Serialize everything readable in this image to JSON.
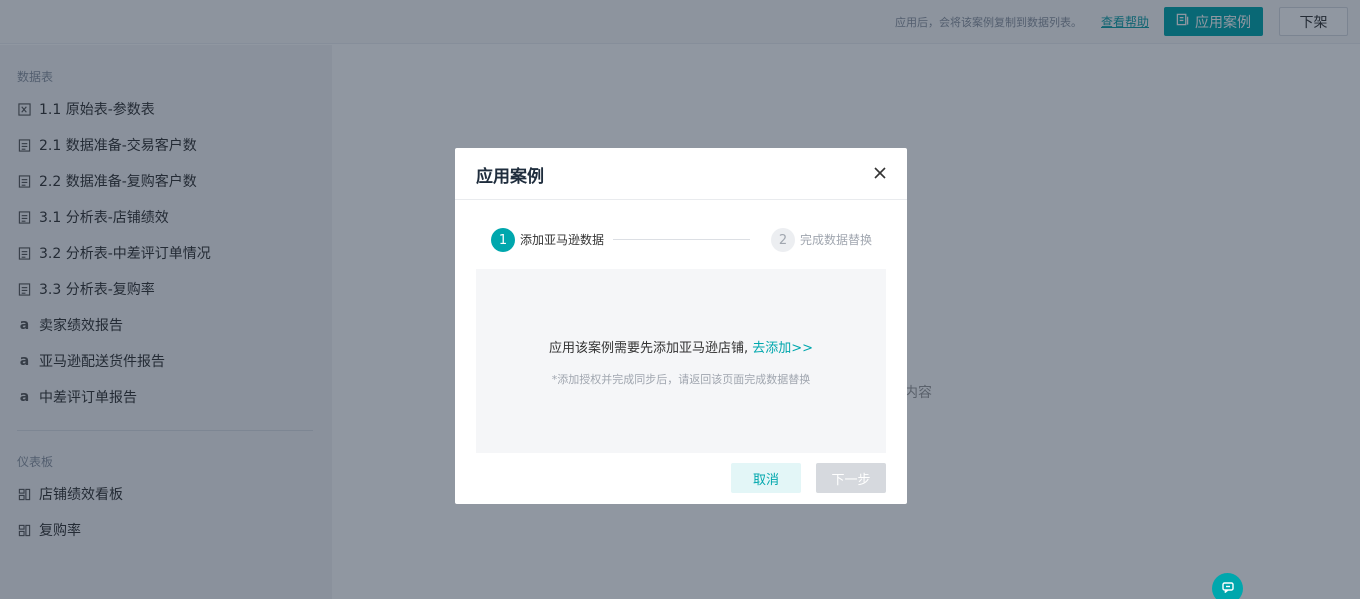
{
  "topbar": {
    "hint": "应用后，会将该案例复制到数据列表。",
    "help_link": "查看帮助",
    "apply_button": "应用案例",
    "remove_button": "下架"
  },
  "sidebar": {
    "datasets_title": "数据表",
    "datasets": [
      {
        "label": "1.1 原始表-参数表",
        "icon": "excel-icon"
      },
      {
        "label": "2.1 数据准备-交易客户数",
        "icon": "sheet-icon"
      },
      {
        "label": "2.2 数据准备-复购客户数",
        "icon": "sheet-icon"
      },
      {
        "label": "3.1 分析表-店铺绩效",
        "icon": "sheet-icon"
      },
      {
        "label": "3.2 分析表-中差评订单情况",
        "icon": "sheet-icon"
      },
      {
        "label": "3.3 分析表-复购率",
        "icon": "sheet-icon"
      },
      {
        "label": "卖家绩效报告",
        "icon": "amazon-icon"
      },
      {
        "label": "亚马逊配送货件报告",
        "icon": "amazon-icon"
      },
      {
        "label": "中差评订单报告",
        "icon": "amazon-icon"
      }
    ],
    "dashboards_title": "仪表板",
    "dashboards": [
      {
        "label": "店铺绩效看板",
        "icon": "dashboard-icon"
      },
      {
        "label": "复购率",
        "icon": "dashboard-icon"
      }
    ]
  },
  "main": {
    "empty_text_fragment": "内容"
  },
  "modal": {
    "title": "应用案例",
    "steps": [
      {
        "number": "1",
        "label": "添加亚马逊数据"
      },
      {
        "number": "2",
        "label": "完成数据替换"
      }
    ],
    "message": "应用该案例需要先添加亚马逊店铺,",
    "message_link": "去添加>>",
    "sub_message": "*添加授权并完成同步后，请返回该页面完成数据替换",
    "cancel_button": "取消",
    "next_button": "下一步"
  },
  "colors": {
    "accent": "#00a7ad",
    "overlay": "rgba(20,35,55,0.47)"
  }
}
